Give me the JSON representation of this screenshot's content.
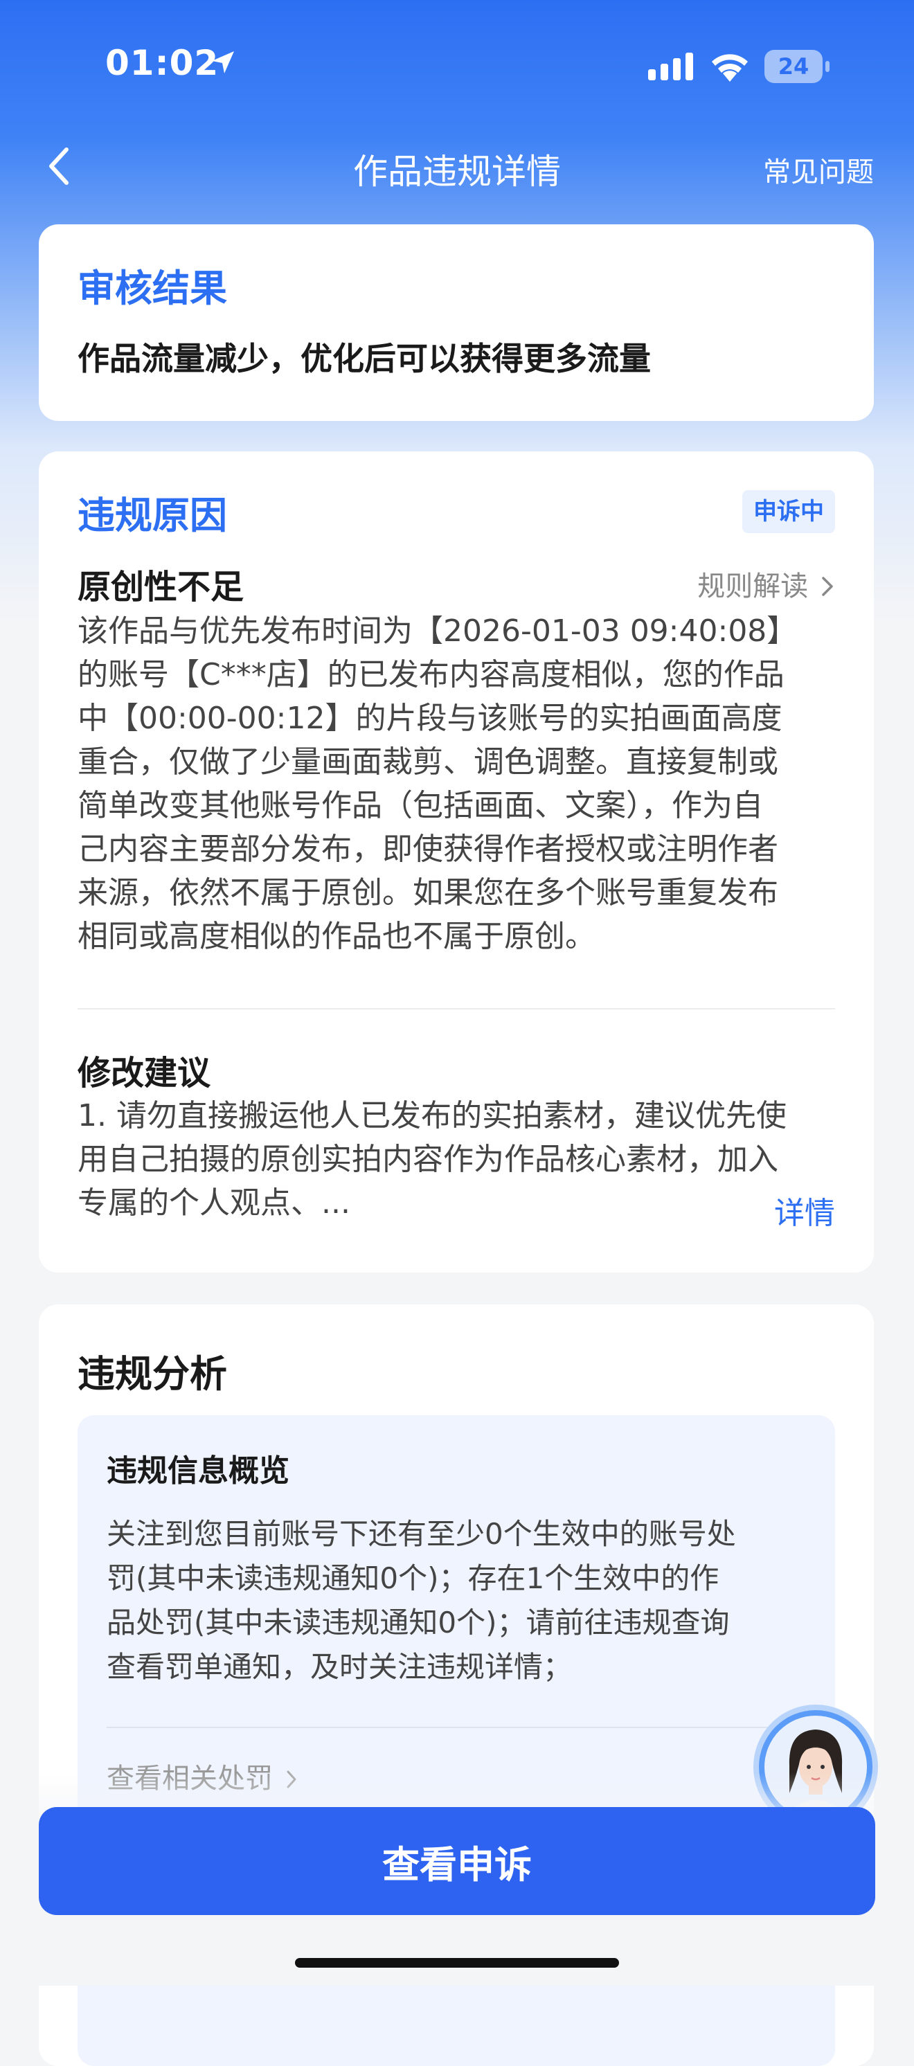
{
  "status_bar": {
    "time": "01:02",
    "battery": "24"
  },
  "nav": {
    "title": "作品违规详情",
    "faq": "常见问题"
  },
  "review": {
    "title": "审核结果",
    "result": "作品流量减少，优化后可以获得更多流量"
  },
  "violation": {
    "title": "违规原因",
    "badge": "申诉中",
    "reason_title": "原创性不足",
    "rule_link": "规则解读",
    "reason_lines": [
      "该作品与优先发布时间为【2026-01-03 09:40:08】",
      "的账号【C***店】的已发布内容高度相似，您的作品",
      "中【00:00-00:12】的片段与该账号的实拍画面高度",
      "重合，仅做了少量画面裁剪、调色调整。直接复制或",
      "简单改变其他账号作品（包括画面、文案），作为自",
      "己内容主要部分发布，即使获得作者授权或注明作者",
      "来源，依然不属于原创。如果您在多个账号重复发布",
      "相同或高度相似的作品也不属于原创。"
    ],
    "suggestion_title": "修改建议",
    "suggestion_lines": [
      "1. 请勿直接搬运他人已发布的实拍素材，建议优先使",
      "用自己拍摄的原创实拍内容作为作品核心素材，加入",
      "专属的个人观点、..."
    ],
    "detail_link": "详情"
  },
  "analysis": {
    "title": "违规分析",
    "overview_title": "违规信息概览",
    "overview_lines": [
      "关注到您目前账号下还有至少0个生效中的账号处",
      "罚(其中未读违规通知0个)；存在1个生效中的作",
      "品处罚(其中未读违规通知0个)；请前往违规查询",
      "查看罚单通知，及时关注违规详情；"
    ],
    "related_link": "查看相关处罚"
  },
  "footer": {
    "button": "查看申诉"
  },
  "icons": {
    "back": "chevron-left-icon",
    "location": "location-arrow-icon",
    "avatar": "assistant-avatar-icon"
  }
}
